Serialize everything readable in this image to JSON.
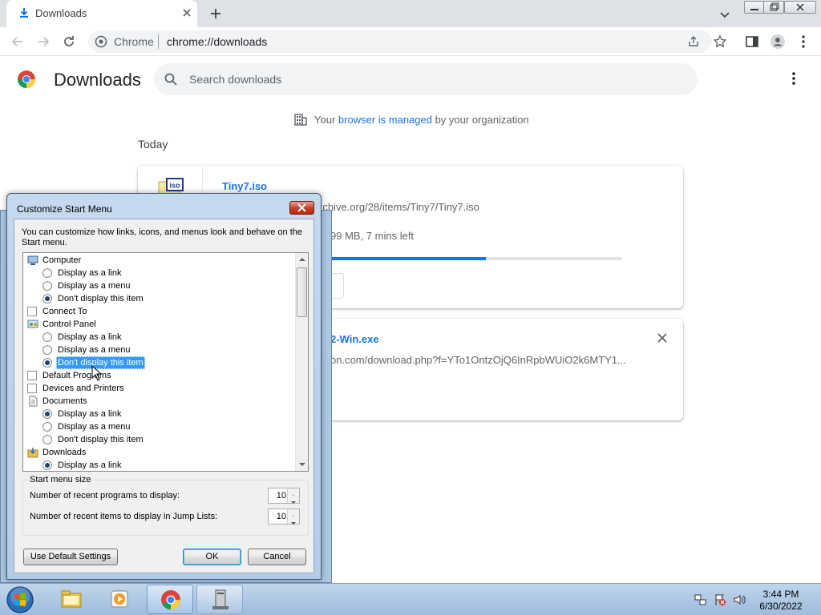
{
  "browser": {
    "tab": {
      "title": "Downloads"
    },
    "omnibox": {
      "site_label": "Chrome",
      "url": "chrome://downloads"
    }
  },
  "downloads_page": {
    "title": "Downloads",
    "search": {
      "placeholder": "Search downloads"
    },
    "managed": {
      "prefix": "Your",
      "link": "browser is managed",
      "suffix": "by your organization"
    },
    "section_label": "Today",
    "items": [
      {
        "icon": "iso-file-icon",
        "icon_text": "iso",
        "name": "Tiny7.iso",
        "url_visible": "rchive.org/28/items/Tiny7/Tiny7.iso",
        "status_visible": "99 MB, 7 mins left",
        "progress": 0.66
      },
      {
        "name_visible": "2-Win.exe",
        "url_visible": "on.com/download.php?f=YTo1OntzOjQ6InRpbWUiO2k6MTY1..."
      }
    ]
  },
  "dialog": {
    "title": "Customize Start Menu",
    "description": "You can customize how links, icons, and menus look and behave on the Start menu.",
    "list_items": [
      {
        "kind": "header",
        "icon": "computer-icon",
        "label": "Computer"
      },
      {
        "kind": "radio",
        "label": "Display as a link",
        "checked": false
      },
      {
        "kind": "radio",
        "label": "Display as a menu",
        "checked": false
      },
      {
        "kind": "radio",
        "label": "Don't display this item",
        "checked": true
      },
      {
        "kind": "checkbox",
        "label": "Connect To",
        "checked": false
      },
      {
        "kind": "header",
        "icon": "control-panel-icon",
        "label": "Control Panel"
      },
      {
        "kind": "radio",
        "label": "Display as a link",
        "checked": false
      },
      {
        "kind": "radio",
        "label": "Display as a menu",
        "checked": false
      },
      {
        "kind": "radio",
        "label": "Don't display this item",
        "checked": true,
        "selected": true
      },
      {
        "kind": "checkbox",
        "label": "Default Programs",
        "checked": false
      },
      {
        "kind": "checkbox",
        "label": "Devices and Printers",
        "checked": false
      },
      {
        "kind": "header",
        "icon": "documents-icon",
        "label": "Documents"
      },
      {
        "kind": "radio",
        "label": "Display as a link",
        "checked": true
      },
      {
        "kind": "radio",
        "label": "Display as a menu",
        "checked": false
      },
      {
        "kind": "radio",
        "label": "Don't display this item",
        "checked": false
      },
      {
        "kind": "header",
        "icon": "downloads-folder-icon",
        "label": "Downloads"
      },
      {
        "kind": "radio",
        "label": "Display as a link",
        "checked": true
      }
    ],
    "size_group": {
      "legend": "Start menu size",
      "recent_programs_label": "Number of recent programs to display:",
      "recent_programs_value": "10",
      "jump_list_label": "Number of recent items to display in Jump Lists:",
      "jump_list_value": "10"
    },
    "buttons": {
      "defaults": "Use Default Settings",
      "ok": "OK",
      "cancel": "Cancel"
    }
  },
  "taskbar": {
    "clock_time": "3:44 PM",
    "clock_date": "6/30/2022"
  },
  "colors": {
    "chrome_accent": "#1a73e8",
    "selection": "#3399ff",
    "taskbar": "#aec7e3"
  }
}
